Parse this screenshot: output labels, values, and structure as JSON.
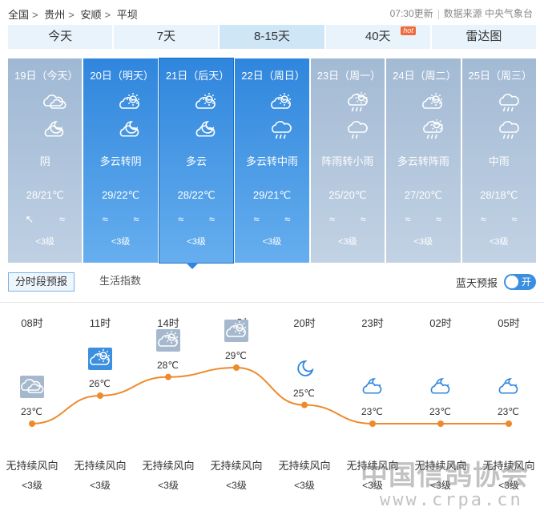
{
  "breadcrumb": [
    "全国",
    "贵州",
    "安顺",
    "平坝"
  ],
  "breadcrumb_sep": ">",
  "update_time": "07:30更新",
  "data_source": "数据来源 中央气象台",
  "tabs": [
    {
      "label": "今天"
    },
    {
      "label": "7天"
    },
    {
      "label": "8-15天"
    },
    {
      "label": "40天",
      "badge": "hot"
    },
    {
      "label": "雷达图"
    }
  ],
  "days": [
    {
      "date": "19日（今天）",
      "icon_day": "cloudy-icon",
      "icon_night": "partly-cloudy-night-icon",
      "weather": "阴",
      "temp": "28/21℃",
      "wind_dir": "↖ ≈",
      "wind_level": "<3级"
    },
    {
      "date": "20日（明天）",
      "icon_day": "partly-cloudy-icon",
      "icon_night": "partly-cloudy-night-icon",
      "weather": "多云转阴",
      "temp": "29/22℃",
      "wind_dir": "≈ ≈",
      "wind_level": "<3级"
    },
    {
      "date": "21日（后天）",
      "icon_day": "partly-cloudy-icon",
      "icon_night": "partly-cloudy-night-icon",
      "weather": "多云",
      "temp": "28/22℃",
      "wind_dir": "≈ ≈",
      "wind_level": "<3级"
    },
    {
      "date": "22日（周日）",
      "icon_day": "partly-cloudy-icon",
      "icon_night": "rain-icon",
      "weather": "多云转中雨",
      "temp": "29/21℃",
      "wind_dir": "≈ ≈",
      "wind_level": "<3级"
    },
    {
      "date": "23日（周一）",
      "icon_day": "shower-icon",
      "icon_night": "light-rain-icon",
      "weather": "阵雨转小雨",
      "temp": "25/20℃",
      "wind_dir": "≈ ≈",
      "wind_level": "<3级"
    },
    {
      "date": "24日（周二）",
      "icon_day": "partly-cloudy-icon",
      "icon_night": "shower-icon",
      "weather": "多云转阵雨",
      "temp": "27/20℃",
      "wind_dir": "≈ ≈",
      "wind_level": "<3级"
    },
    {
      "date": "25日（周三）",
      "icon_day": "rain-icon",
      "icon_night": "rain-icon",
      "weather": "中雨",
      "temp": "28/18℃",
      "wind_dir": "≈ ≈",
      "wind_level": "<3级"
    }
  ],
  "subtabs": {
    "active": "分时段预报",
    "other": "生活指数"
  },
  "sunny_forecast": {
    "label": "蓝天预报",
    "toggle": "开"
  },
  "hourly": [
    {
      "hour": "08时",
      "temp": "23℃",
      "temp_value": 23,
      "icon": "cloudy-icon",
      "wind_dir": "无持续风向",
      "wind_level": "<3级"
    },
    {
      "hour": "11时",
      "temp": "26℃",
      "temp_value": 26,
      "icon": "partly-cloudy-icon",
      "wind_dir": "无持续风向",
      "wind_level": "<3级"
    },
    {
      "hour": "14时",
      "temp": "28℃",
      "temp_value": 28,
      "icon": "partly-cloudy-icon",
      "wind_dir": "无持续风向",
      "wind_level": "<3级"
    },
    {
      "hour": "17时",
      "temp": "29℃",
      "temp_value": 29,
      "icon": "partly-cloudy-icon",
      "wind_dir": "无持续风向",
      "wind_level": "<3级"
    },
    {
      "hour": "20时",
      "temp": "25℃",
      "temp_value": 25,
      "icon": "moon-icon",
      "wind_dir": "无持续风向",
      "wind_level": "<3级"
    },
    {
      "hour": "23时",
      "temp": "23℃",
      "temp_value": 23,
      "icon": "partly-cloudy-night-icon",
      "wind_dir": "无持续风向",
      "wind_level": "<3级"
    },
    {
      "hour": "02时",
      "temp": "23℃",
      "temp_value": 23,
      "icon": "partly-cloudy-night-icon",
      "wind_dir": "无持续风向",
      "wind_level": "<3级"
    },
    {
      "hour": "05时",
      "temp": "23℃",
      "temp_value": 23,
      "icon": "partly-cloudy-night-icon",
      "wind_dir": "无持续风向",
      "wind_level": "<3级"
    }
  ],
  "watermark": {
    "text": "中国信鸽协会",
    "url": "www.crpa.cn"
  },
  "colors": {
    "accent": "#2f86dd",
    "curve": "#ee8a2c",
    "tab_bg": "#e8f3fb",
    "hot": "#ef6b3b"
  }
}
